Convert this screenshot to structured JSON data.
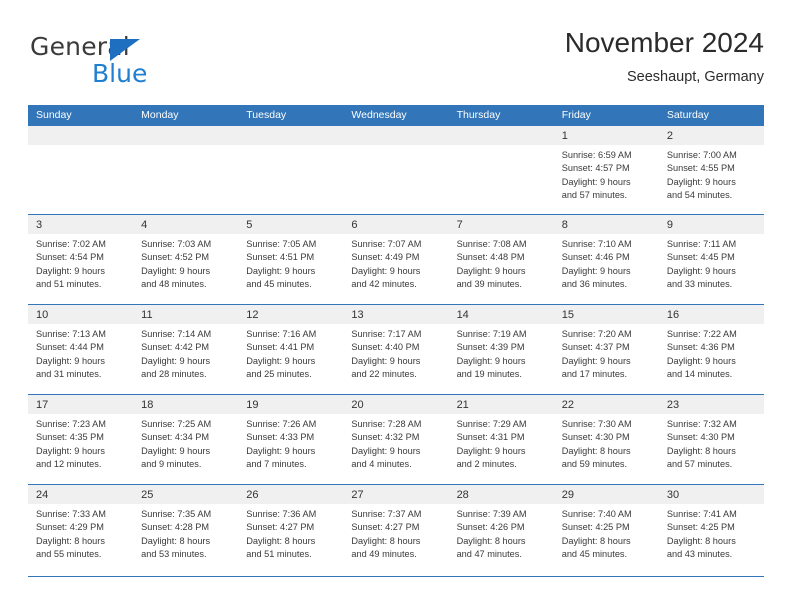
{
  "brand": {
    "word_general": "General",
    "word_blue": "Blue",
    "triangle_color": "#1f6fc0",
    "blue_text_color": "#1f7fd0"
  },
  "header": {
    "title": "November 2024",
    "subtitle": "Seeshaupt, Germany"
  },
  "colors": {
    "header_row_background": "#3275b8",
    "header_row_text": "#ffffff",
    "day_number_bar": "#f0f0f0",
    "grid_line": "#3275b8",
    "body_text": "#3a3a3a"
  },
  "weekdays": [
    "Sunday",
    "Monday",
    "Tuesday",
    "Wednesday",
    "Thursday",
    "Friday",
    "Saturday"
  ],
  "weeks": [
    {
      "days": [
        {
          "number": "",
          "empty": true,
          "lines": []
        },
        {
          "number": "",
          "empty": true,
          "lines": []
        },
        {
          "number": "",
          "empty": true,
          "lines": []
        },
        {
          "number": "",
          "empty": true,
          "lines": []
        },
        {
          "number": "",
          "empty": true,
          "lines": []
        },
        {
          "number": "1",
          "empty": false,
          "sunrise": "Sunrise: 6:59 AM",
          "sunset": "Sunset: 4:57 PM",
          "daylight_1": "Daylight: 9 hours",
          "daylight_2": "and 57 minutes."
        },
        {
          "number": "2",
          "empty": false,
          "sunrise": "Sunrise: 7:00 AM",
          "sunset": "Sunset: 4:55 PM",
          "daylight_1": "Daylight: 9 hours",
          "daylight_2": "and 54 minutes."
        }
      ]
    },
    {
      "days": [
        {
          "number": "3",
          "empty": false,
          "sunrise": "Sunrise: 7:02 AM",
          "sunset": "Sunset: 4:54 PM",
          "daylight_1": "Daylight: 9 hours",
          "daylight_2": "and 51 minutes."
        },
        {
          "number": "4",
          "empty": false,
          "sunrise": "Sunrise: 7:03 AM",
          "sunset": "Sunset: 4:52 PM",
          "daylight_1": "Daylight: 9 hours",
          "daylight_2": "and 48 minutes."
        },
        {
          "number": "5",
          "empty": false,
          "sunrise": "Sunrise: 7:05 AM",
          "sunset": "Sunset: 4:51 PM",
          "daylight_1": "Daylight: 9 hours",
          "daylight_2": "and 45 minutes."
        },
        {
          "number": "6",
          "empty": false,
          "sunrise": "Sunrise: 7:07 AM",
          "sunset": "Sunset: 4:49 PM",
          "daylight_1": "Daylight: 9 hours",
          "daylight_2": "and 42 minutes."
        },
        {
          "number": "7",
          "empty": false,
          "sunrise": "Sunrise: 7:08 AM",
          "sunset": "Sunset: 4:48 PM",
          "daylight_1": "Daylight: 9 hours",
          "daylight_2": "and 39 minutes."
        },
        {
          "number": "8",
          "empty": false,
          "sunrise": "Sunrise: 7:10 AM",
          "sunset": "Sunset: 4:46 PM",
          "daylight_1": "Daylight: 9 hours",
          "daylight_2": "and 36 minutes."
        },
        {
          "number": "9",
          "empty": false,
          "sunrise": "Sunrise: 7:11 AM",
          "sunset": "Sunset: 4:45 PM",
          "daylight_1": "Daylight: 9 hours",
          "daylight_2": "and 33 minutes."
        }
      ]
    },
    {
      "days": [
        {
          "number": "10",
          "empty": false,
          "sunrise": "Sunrise: 7:13 AM",
          "sunset": "Sunset: 4:44 PM",
          "daylight_1": "Daylight: 9 hours",
          "daylight_2": "and 31 minutes."
        },
        {
          "number": "11",
          "empty": false,
          "sunrise": "Sunrise: 7:14 AM",
          "sunset": "Sunset: 4:42 PM",
          "daylight_1": "Daylight: 9 hours",
          "daylight_2": "and 28 minutes."
        },
        {
          "number": "12",
          "empty": false,
          "sunrise": "Sunrise: 7:16 AM",
          "sunset": "Sunset: 4:41 PM",
          "daylight_1": "Daylight: 9 hours",
          "daylight_2": "and 25 minutes."
        },
        {
          "number": "13",
          "empty": false,
          "sunrise": "Sunrise: 7:17 AM",
          "sunset": "Sunset: 4:40 PM",
          "daylight_1": "Daylight: 9 hours",
          "daylight_2": "and 22 minutes."
        },
        {
          "number": "14",
          "empty": false,
          "sunrise": "Sunrise: 7:19 AM",
          "sunset": "Sunset: 4:39 PM",
          "daylight_1": "Daylight: 9 hours",
          "daylight_2": "and 19 minutes."
        },
        {
          "number": "15",
          "empty": false,
          "sunrise": "Sunrise: 7:20 AM",
          "sunset": "Sunset: 4:37 PM",
          "daylight_1": "Daylight: 9 hours",
          "daylight_2": "and 17 minutes."
        },
        {
          "number": "16",
          "empty": false,
          "sunrise": "Sunrise: 7:22 AM",
          "sunset": "Sunset: 4:36 PM",
          "daylight_1": "Daylight: 9 hours",
          "daylight_2": "and 14 minutes."
        }
      ]
    },
    {
      "days": [
        {
          "number": "17",
          "empty": false,
          "sunrise": "Sunrise: 7:23 AM",
          "sunset": "Sunset: 4:35 PM",
          "daylight_1": "Daylight: 9 hours",
          "daylight_2": "and 12 minutes."
        },
        {
          "number": "18",
          "empty": false,
          "sunrise": "Sunrise: 7:25 AM",
          "sunset": "Sunset: 4:34 PM",
          "daylight_1": "Daylight: 9 hours",
          "daylight_2": "and 9 minutes."
        },
        {
          "number": "19",
          "empty": false,
          "sunrise": "Sunrise: 7:26 AM",
          "sunset": "Sunset: 4:33 PM",
          "daylight_1": "Daylight: 9 hours",
          "daylight_2": "and 7 minutes."
        },
        {
          "number": "20",
          "empty": false,
          "sunrise": "Sunrise: 7:28 AM",
          "sunset": "Sunset: 4:32 PM",
          "daylight_1": "Daylight: 9 hours",
          "daylight_2": "and 4 minutes."
        },
        {
          "number": "21",
          "empty": false,
          "sunrise": "Sunrise: 7:29 AM",
          "sunset": "Sunset: 4:31 PM",
          "daylight_1": "Daylight: 9 hours",
          "daylight_2": "and 2 minutes."
        },
        {
          "number": "22",
          "empty": false,
          "sunrise": "Sunrise: 7:30 AM",
          "sunset": "Sunset: 4:30 PM",
          "daylight_1": "Daylight: 8 hours",
          "daylight_2": "and 59 minutes."
        },
        {
          "number": "23",
          "empty": false,
          "sunrise": "Sunrise: 7:32 AM",
          "sunset": "Sunset: 4:30 PM",
          "daylight_1": "Daylight: 8 hours",
          "daylight_2": "and 57 minutes."
        }
      ]
    },
    {
      "days": [
        {
          "number": "24",
          "empty": false,
          "sunrise": "Sunrise: 7:33 AM",
          "sunset": "Sunset: 4:29 PM",
          "daylight_1": "Daylight: 8 hours",
          "daylight_2": "and 55 minutes."
        },
        {
          "number": "25",
          "empty": false,
          "sunrise": "Sunrise: 7:35 AM",
          "sunset": "Sunset: 4:28 PM",
          "daylight_1": "Daylight: 8 hours",
          "daylight_2": "and 53 minutes."
        },
        {
          "number": "26",
          "empty": false,
          "sunrise": "Sunrise: 7:36 AM",
          "sunset": "Sunset: 4:27 PM",
          "daylight_1": "Daylight: 8 hours",
          "daylight_2": "and 51 minutes."
        },
        {
          "number": "27",
          "empty": false,
          "sunrise": "Sunrise: 7:37 AM",
          "sunset": "Sunset: 4:27 PM",
          "daylight_1": "Daylight: 8 hours",
          "daylight_2": "and 49 minutes."
        },
        {
          "number": "28",
          "empty": false,
          "sunrise": "Sunrise: 7:39 AM",
          "sunset": "Sunset: 4:26 PM",
          "daylight_1": "Daylight: 8 hours",
          "daylight_2": "and 47 minutes."
        },
        {
          "number": "29",
          "empty": false,
          "sunrise": "Sunrise: 7:40 AM",
          "sunset": "Sunset: 4:25 PM",
          "daylight_1": "Daylight: 8 hours",
          "daylight_2": "and 45 minutes."
        },
        {
          "number": "30",
          "empty": false,
          "sunrise": "Sunrise: 7:41 AM",
          "sunset": "Sunset: 4:25 PM",
          "daylight_1": "Daylight: 8 hours",
          "daylight_2": "and 43 minutes."
        }
      ]
    }
  ]
}
